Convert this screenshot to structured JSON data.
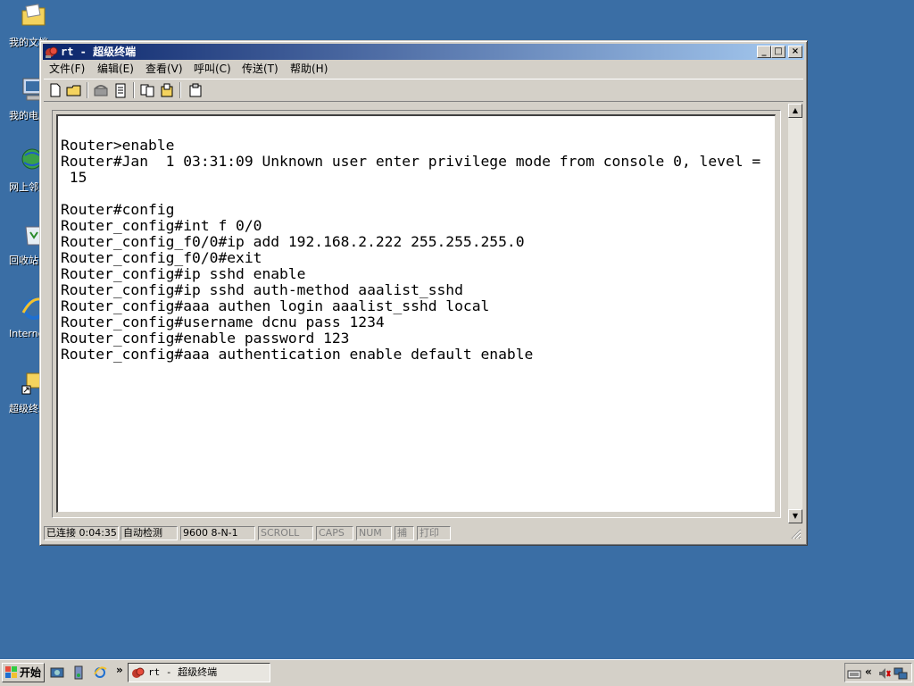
{
  "desktop": {
    "icons": [
      {
        "label": "我的文档",
        "icon": "folder-documents-icon"
      },
      {
        "label": "我的电脑",
        "icon": "computer-icon"
      },
      {
        "label": "网上邻居",
        "icon": "network-icon"
      },
      {
        "label": "回收站",
        "icon": "recycle-bin-icon"
      },
      {
        "label": "Internet Explorer",
        "icon": "ie-icon"
      },
      {
        "label": "超级终端",
        "icon": "hyperterminal-shortcut-icon"
      }
    ]
  },
  "window": {
    "title": "rt - 超级终端",
    "minimize_glyph": "_",
    "maximize_glyph": "□",
    "close_glyph": "×",
    "menu": [
      "文件(F)",
      "编辑(E)",
      "查看(V)",
      "呼叫(C)",
      "传送(T)",
      "帮助(H)"
    ],
    "toolbar": [
      "new-icon",
      "open-icon",
      "disconnect-phone-icon",
      "connect-phone-icon",
      "send-file-icon",
      "receive-file-icon",
      "properties-icon"
    ]
  },
  "terminal": {
    "lines": [
      "Router>enable",
      "Router#Jan  1 03:31:09 Unknown user enter privilege mode from console 0, level =",
      " 15",
      "",
      "Router#config",
      "Router_config#int f 0/0",
      "Router_config_f0/0#ip add 192.168.2.222 255.255.255.0",
      "Router_config_f0/0#exit",
      "Router_config#ip sshd enable",
      "Router_config#ip sshd auth-method aaalist_sshd",
      "Router_config#aaa authen login aaalist_sshd local",
      "Router_config#username dcnu pass 1234",
      "Router_config#enable password 123",
      "Router_config#aaa authentication enable default enable"
    ]
  },
  "statusbar": {
    "connected": "已连接 0:04:35",
    "detect": "自动检测",
    "params": "9600 8-N-1",
    "scroll": "SCROLL",
    "caps": "CAPS",
    "num": "NUM",
    "capture": "捕",
    "print": "打印"
  },
  "taskbar": {
    "start_label": "开始",
    "quicklaunch": [
      "show-desktop-icon",
      "server-manager-icon",
      "ie-icon"
    ],
    "chevron": "»",
    "task_label": "rt - 超级终端",
    "tray_chevron": "«",
    "tray_icons": [
      "keyboard-icon",
      "volume-icon",
      "network-icon"
    ]
  },
  "colors": {
    "desktop": "#3a6ea5",
    "titlebar_start": "#0a246a",
    "titlebar_end": "#a6caf0",
    "face": "#d4d0c8"
  }
}
